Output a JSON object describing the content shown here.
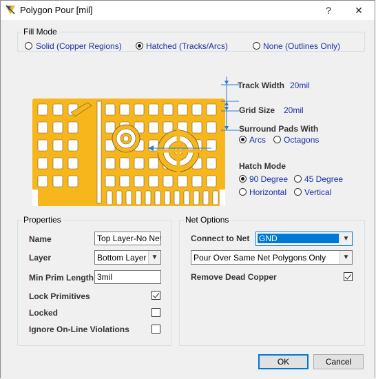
{
  "window": {
    "title": "Polygon Pour [mil]",
    "help_label": "?",
    "close_label": "✕"
  },
  "fill_mode": {
    "legend": "Fill Mode",
    "options": [
      {
        "label": "Solid (Copper Regions)",
        "selected": false
      },
      {
        "label": "Hatched (Tracks/Arcs)",
        "selected": true
      },
      {
        "label": "None (Outlines Only)",
        "selected": false
      }
    ]
  },
  "hatch": {
    "track_width_label": "Track Width",
    "track_width_value": "20mil",
    "grid_size_label": "Grid Size",
    "grid_size_value": "20mil",
    "surround_label": "Surround Pads With",
    "surround_options": [
      {
        "label": "Arcs",
        "selected": true
      },
      {
        "label": "Octagons",
        "selected": false
      }
    ],
    "hatch_mode_label": "Hatch Mode",
    "hatch_options": [
      {
        "label": "90 Degree",
        "selected": true
      },
      {
        "label": "45 Degree",
        "selected": false
      },
      {
        "label": "Horizontal",
        "selected": false
      },
      {
        "label": "Vertical",
        "selected": false
      }
    ]
  },
  "properties": {
    "legend": "Properties",
    "name_label": "Name",
    "name_value": "Top Layer-No Net",
    "layer_label": "Layer",
    "layer_value": "Bottom Layer",
    "min_prim_label": "Min Prim Length",
    "min_prim_value": "3mil",
    "lock_primitives_label": "Lock Primitives",
    "lock_primitives": true,
    "locked_label": "Locked",
    "locked": false,
    "ignore_label": "Ignore On-Line Violations",
    "ignore": false
  },
  "net_options": {
    "legend": "Net Options",
    "connect_label": "Connect to Net",
    "connect_value": "GND",
    "pour_value": "Pour Over Same Net Polygons Only",
    "remove_dead_label": "Remove Dead Copper",
    "remove_dead": true
  },
  "buttons": {
    "ok": "OK",
    "cancel": "Cancel"
  },
  "colors": {
    "copper": "#f6b61c",
    "accent": "#0078d7",
    "dim_line": "#2a7bd6"
  }
}
